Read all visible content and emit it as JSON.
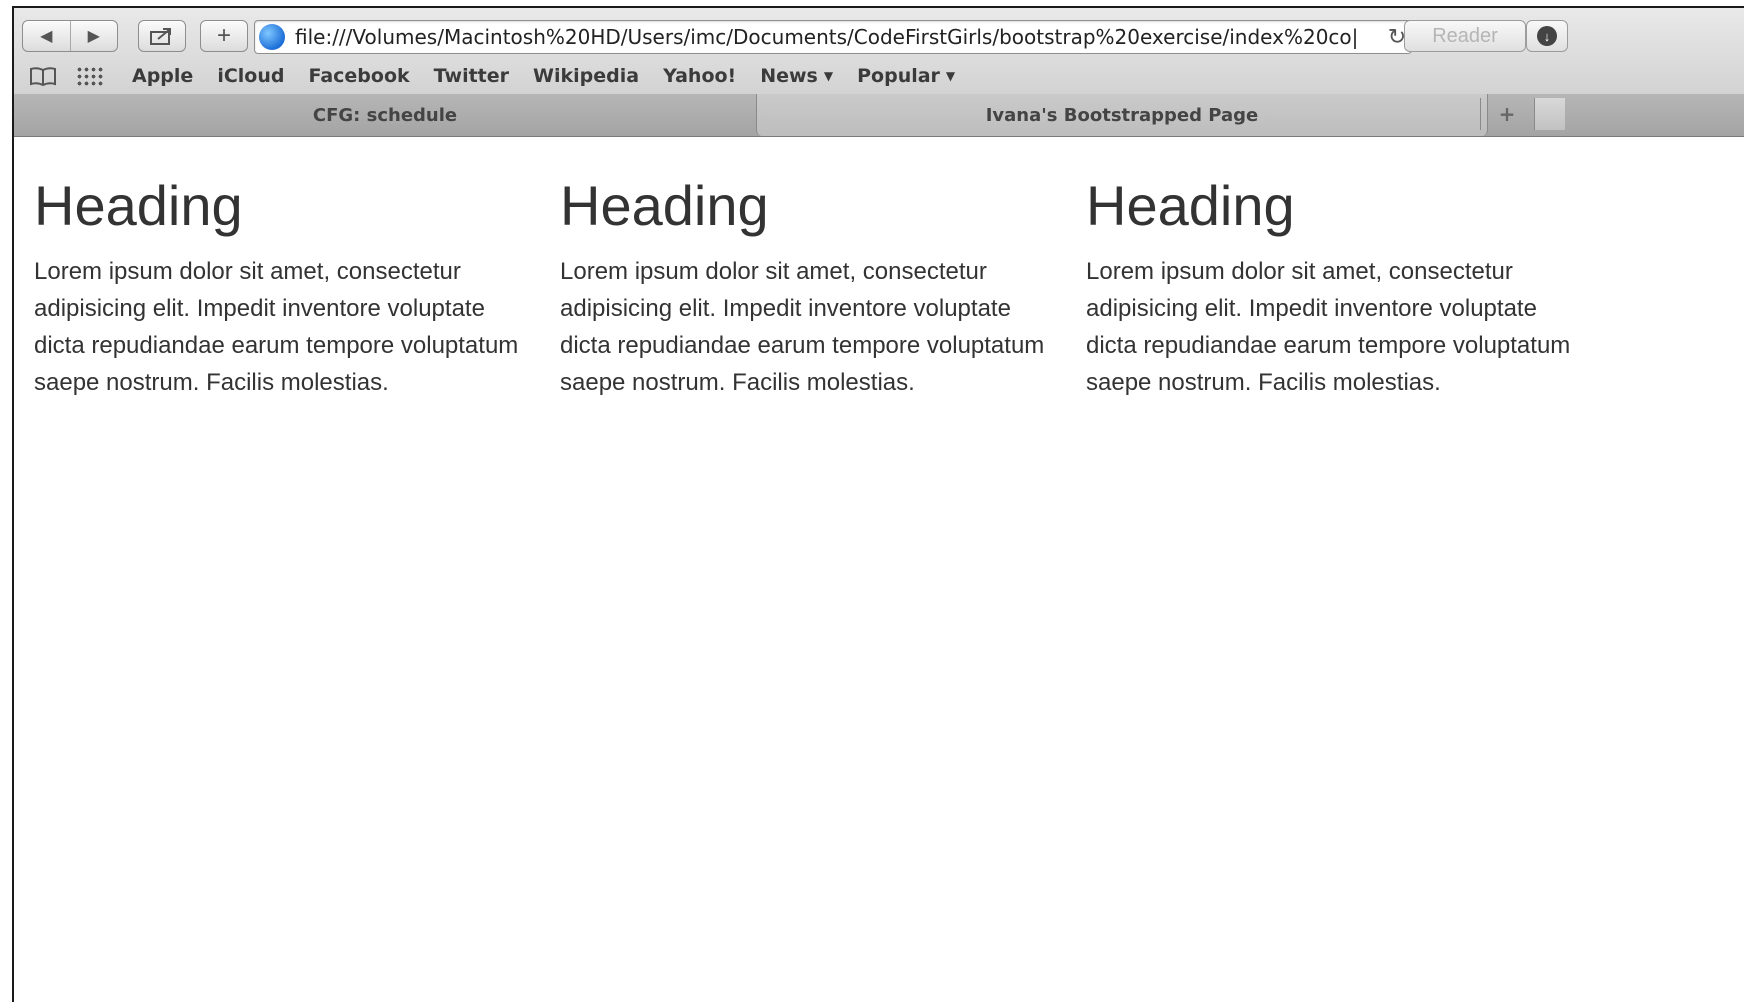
{
  "browser": {
    "url": "file:///Volumes/Macintosh%20HD/Users/imc/Documents/CodeFirstGirls/bootstrap%20exercise/index%20co|",
    "reader_label": "Reader",
    "back_icon": "◀",
    "forward_icon": "▶",
    "add_icon": "+",
    "reload_icon": "↻"
  },
  "bookmarks": [
    "Apple",
    "iCloud",
    "Facebook",
    "Twitter",
    "Wikipedia",
    "Yahoo!"
  ],
  "bookmark_menus": [
    "News",
    "Popular"
  ],
  "tabs": [
    {
      "title": "CFG: schedule"
    },
    {
      "title": "Ivana's Bootstrapped Page"
    }
  ],
  "columns": [
    {
      "heading": "Heading",
      "text": "Lorem ipsum dolor sit amet, consectetur adipisicing elit. Impedit inventore voluptate dicta repudiandae earum tempore voluptatum saepe nostrum. Facilis molestias."
    },
    {
      "heading": "Heading",
      "text": "Lorem ipsum dolor sit amet, consectetur adipisicing elit. Impedit inventore voluptate dicta repudiandae earum tempore voluptatum saepe nostrum. Facilis molestias."
    },
    {
      "heading": "Heading",
      "text": "Lorem ipsum dolor sit amet, consectetur adipisicing elit. Impedit inventore voluptate dicta repudiandae earum tempore voluptatum saepe nostrum. Facilis molestias."
    }
  ]
}
